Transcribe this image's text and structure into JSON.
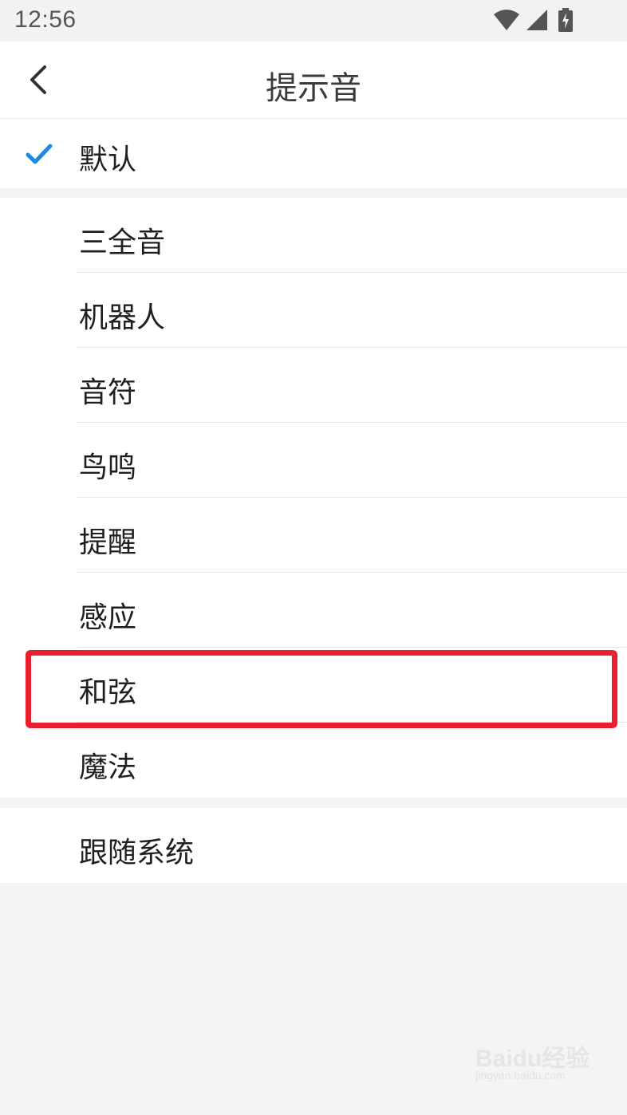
{
  "status_bar": {
    "time": "12:56",
    "icons": [
      "wifi-icon",
      "cellular-signal-icon",
      "battery-charging-icon"
    ]
  },
  "header": {
    "title": "提示音",
    "back_icon": "chevron-left-icon"
  },
  "default_option": {
    "label": "默认",
    "selected": true,
    "check_color": "#1e88e5"
  },
  "tones": [
    {
      "label": "三全音"
    },
    {
      "label": "机器人"
    },
    {
      "label": "音符"
    },
    {
      "label": "鸟鸣"
    },
    {
      "label": "提醒"
    },
    {
      "label": "感应"
    },
    {
      "label": "和弦"
    },
    {
      "label": "魔法"
    }
  ],
  "system_option": {
    "label": "跟随系统"
  },
  "highlight": {
    "target": "和弦",
    "color": "#e8212e"
  },
  "watermark": {
    "text": "Baidu经验",
    "sub": "jingyan.baidu.com"
  }
}
